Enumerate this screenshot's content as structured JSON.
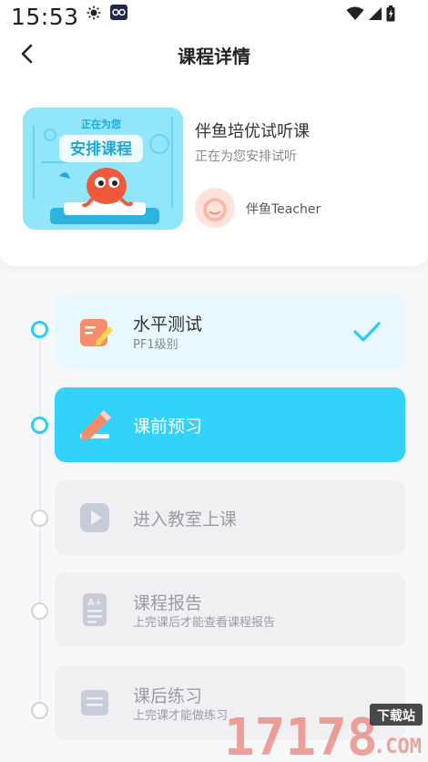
{
  "status_bar": {
    "time": "15:53"
  },
  "topbar": {
    "title": "课程详情"
  },
  "course": {
    "name": "伴鱼培优试听课",
    "subtitle": "正在为您安排试听",
    "thumb_line1": "正在为您",
    "thumb_line2": "安排课程",
    "teacher": "伴鱼Teacher"
  },
  "steps": [
    {
      "title": "水平测试",
      "subtitle": "PF1级别",
      "state": "done",
      "icon": "pencil-test-icon"
    },
    {
      "title": "课前预习",
      "subtitle": "",
      "state": "current",
      "icon": "pencil-icon"
    },
    {
      "title": "进入教室上课",
      "subtitle": "",
      "state": "locked",
      "icon": "play-icon"
    },
    {
      "title": "课程报告",
      "subtitle": "上完课后才能查看课程报告",
      "state": "locked",
      "icon": "report-icon"
    },
    {
      "title": "课后练习",
      "subtitle": "上完课才能做练习",
      "state": "locked",
      "icon": "exercise-icon"
    }
  ],
  "watermark": {
    "text": "17178",
    "badge": "下载站",
    "domain": ".COM"
  },
  "colors": {
    "accent": "#33d2fb",
    "done_bg": "#e9f8fe",
    "locked_bg": "#f0f0f3",
    "check": "#2ccdf2"
  }
}
